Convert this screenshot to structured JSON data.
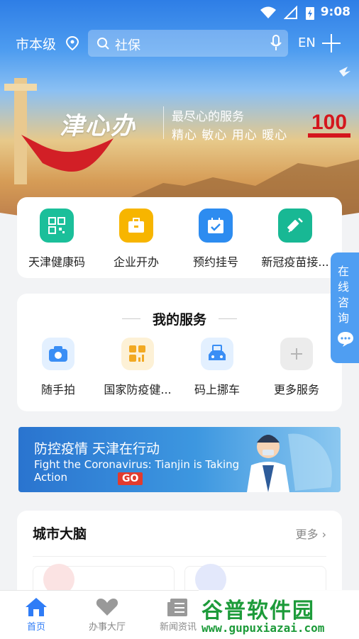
{
  "status_bar": {
    "time": "9:08"
  },
  "top_bar": {
    "city": "市本级",
    "search_placeholder": "社保",
    "lang": "EN"
  },
  "hero": {
    "brand": "津心办",
    "slogan_line1": "最尽心的服务",
    "slogan_line2": "精心 敏心 用心 暖心",
    "badge_number": "100"
  },
  "quick_actions": [
    {
      "label": "天津健康码",
      "icon": "qr-code-icon",
      "color": "#1bbf9a"
    },
    {
      "label": "企业开办",
      "icon": "briefcase-icon",
      "color": "#f7b500"
    },
    {
      "label": "预约挂号",
      "icon": "calendar-check-icon",
      "color": "#2d8cf0"
    },
    {
      "label": "新冠疫苗接...",
      "icon": "syringe-icon",
      "color": "#18b894"
    }
  ],
  "my_services": {
    "title": "我的服务",
    "items": [
      {
        "label": "随手拍",
        "icon": "camera-icon"
      },
      {
        "label": "国家防疫健...",
        "icon": "grid-chart-icon"
      },
      {
        "label": "码上挪车",
        "icon": "car-icon"
      },
      {
        "label": "更多服务",
        "icon": "plus-icon"
      }
    ]
  },
  "banner": {
    "title": "防控疫情 天津在行动",
    "subtitle": "Fight the Coronavirus: Tianjin is Taking Action",
    "go": "GO"
  },
  "city_brain": {
    "title": "城市大脑",
    "more": "更多"
  },
  "consult": {
    "label": "在线咨询"
  },
  "tabs": [
    {
      "label": "首页",
      "icon": "home-icon",
      "active": true
    },
    {
      "label": "办事大厅",
      "icon": "heart-hands-icon",
      "active": false
    },
    {
      "label": "新闻资讯",
      "icon": "news-icon",
      "active": false
    }
  ],
  "watermark": {
    "brand": "谷普软件园",
    "url": "www.gupuxiazai.com"
  }
}
